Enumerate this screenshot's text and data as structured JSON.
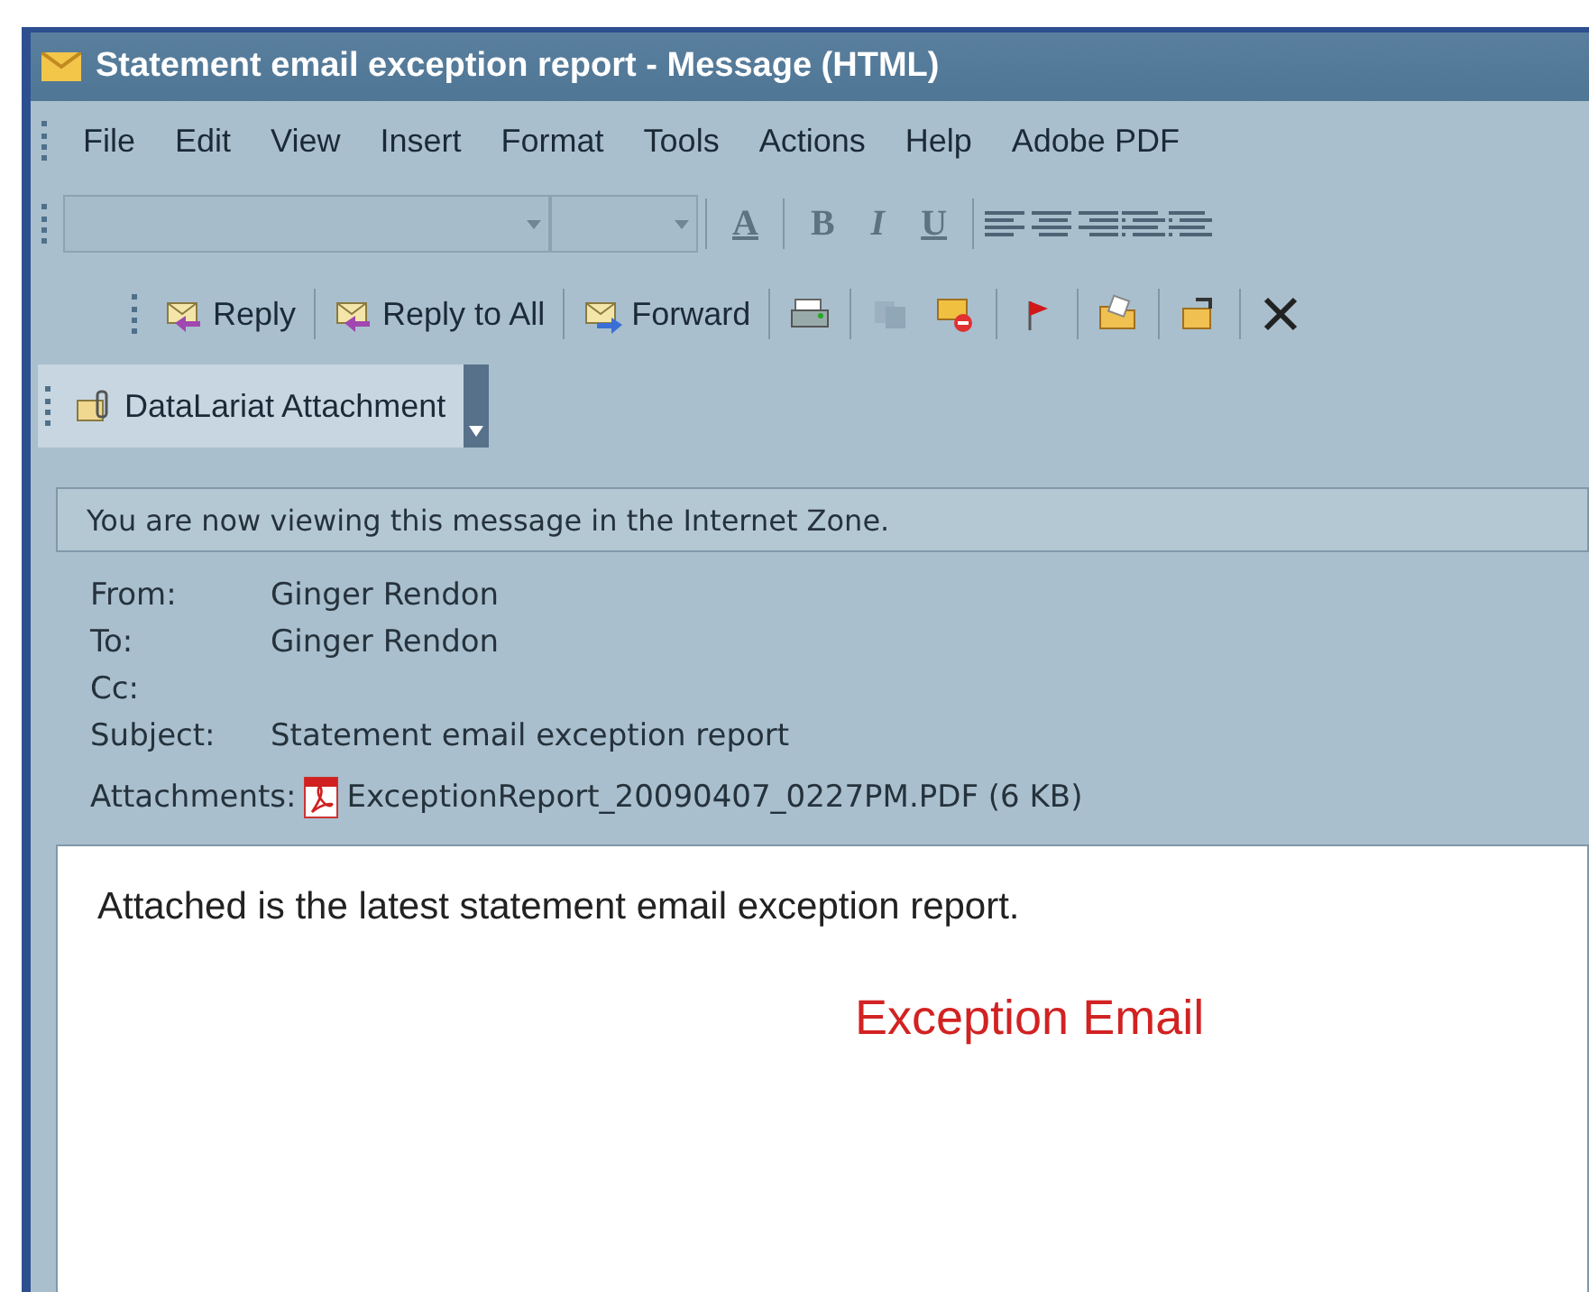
{
  "window": {
    "title": "Statement email exception report - Message (HTML)"
  },
  "menu": [
    "File",
    "Edit",
    "View",
    "Insert",
    "Format",
    "Tools",
    "Actions",
    "Help",
    "Adobe PDF"
  ],
  "format_toolbar": [
    {
      "kind": "font-field"
    },
    {
      "kind": "size-field"
    },
    {
      "kind": "color",
      "label": "A"
    },
    {
      "kind": "style",
      "label": "B"
    },
    {
      "kind": "style",
      "label": "I"
    },
    {
      "kind": "style",
      "label": "U"
    },
    {
      "kind": "align-left"
    },
    {
      "kind": "align-center"
    },
    {
      "kind": "align-right"
    },
    {
      "kind": "bullets"
    },
    {
      "kind": "numbering"
    }
  ],
  "standard_toolbar": [
    {
      "kind": "reply",
      "label": "Reply"
    },
    {
      "kind": "reply-all",
      "label": "Reply to All"
    },
    {
      "kind": "forward",
      "label": "Forward"
    },
    {
      "kind": "print"
    },
    {
      "kind": "copy",
      "disabled": true
    },
    {
      "kind": "junk"
    },
    {
      "kind": "flag"
    },
    {
      "kind": "folder"
    },
    {
      "kind": "move"
    },
    {
      "kind": "delete"
    }
  ],
  "addin_toolbar": {
    "label": "DataLariat Attachment"
  },
  "info_bar": "You are now viewing this message in the Internet Zone.",
  "headers": [
    {
      "label": "From:",
      "value": "Ginger Rendon"
    },
    {
      "label": "To:",
      "value": "Ginger Rendon"
    },
    {
      "label": "Cc:"
    },
    {
      "label": "Subject:",
      "value": "Statement email exception report"
    }
  ],
  "attachments": {
    "label": "Attachments:",
    "file": "ExceptionReport_20090407_0227PM.PDF (6 KB)"
  },
  "body": {
    "text": "Attached is the latest statement email exception report.",
    "heading": "Exception Email"
  }
}
